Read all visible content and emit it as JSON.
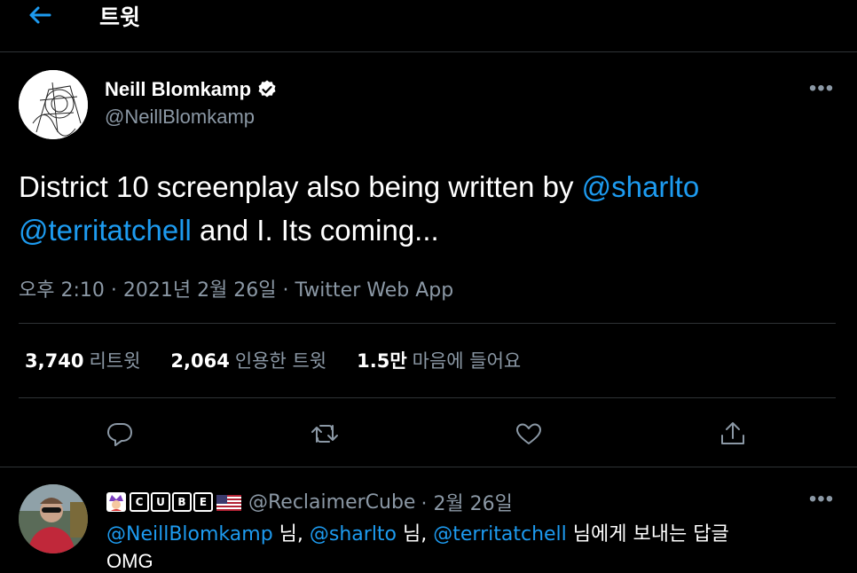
{
  "header": {
    "title": "트윗"
  },
  "tweet": {
    "author_name": "Neill Blomkamp",
    "author_handle": "@NeillBlomkamp",
    "text_part1": "District 10 screenplay also being written by ",
    "mention1": "@sharlto",
    "mention2": "@territatchell",
    "text_part2": " and I. Its coming...",
    "timestamp": "오후 2:10 · 2021년 2월 26일 · Twitter Web App",
    "stats": [
      {
        "count": "3,740",
        "label": "리트윗"
      },
      {
        "count": "2,064",
        "label": "인용한 트윗"
      },
      {
        "count": "1.5만",
        "label": "마음에 들어요"
      }
    ],
    "actions": [
      "reply-icon",
      "retweet-icon",
      "like-icon",
      "share-icon"
    ]
  },
  "reply": {
    "badge_letters": [
      "C",
      "U",
      "B",
      "E"
    ],
    "handle": "@ReclaimerCube",
    "date": "· 2월 26일",
    "reply_to_mention1": "@NeillBlomkamp",
    "reply_to_sep1": " 님, ",
    "reply_to_mention2": "@sharlto",
    "reply_to_sep2": " 님, ",
    "reply_to_mention3": "@territatchell",
    "reply_to_suffix": " 님에게 보내는 답글",
    "text": "OMG"
  },
  "colors": {
    "accent": "#1d9bf0",
    "muted": "#8b98a5",
    "divider": "#2f3336",
    "background": "#000000"
  }
}
